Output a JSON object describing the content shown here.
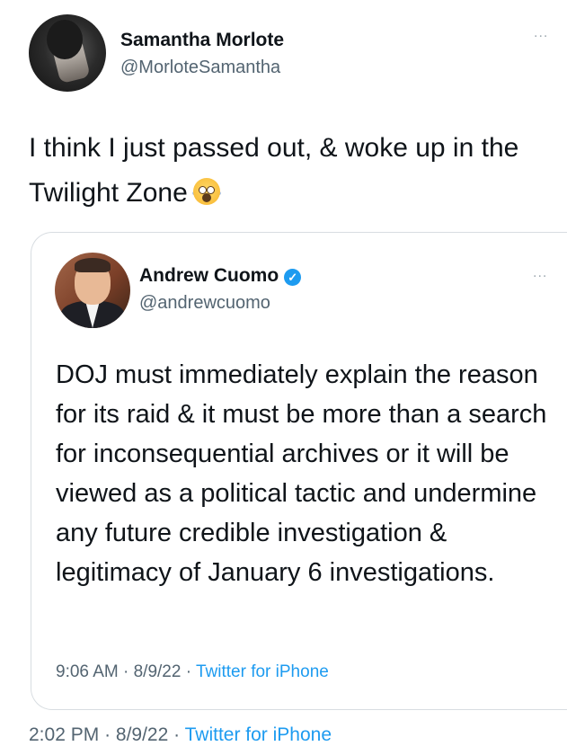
{
  "tweet": {
    "author_name": "Samantha Morlote",
    "author_handle": "@MorloteSamantha",
    "more_icon": "...",
    "text": "I think I just passed out, & woke up in the Twilight Zone",
    "emoji": "face-screaming-in-fear",
    "timestamp": "2:02 PM",
    "date": "8/9/22",
    "separator": "·",
    "source": "Twitter for iPhone"
  },
  "quoted_tweet": {
    "author_name": "Andrew Cuomo",
    "verified_icon": "✓",
    "author_handle": "@andrewcuomo",
    "more_icon": "...",
    "text": "DOJ must immediately explain the reason for its raid & it must be more than a search for inconsequential archives or it will be viewed as a political tactic and undermine any future credible investigation & legitimacy of January 6 investigations.",
    "timestamp": "9:06 AM",
    "date": "8/9/22",
    "separator": "·",
    "source": "Twitter for iPhone"
  },
  "colors": {
    "text": "#0f1419",
    "secondary": "#536471",
    "link": "#1d9bf0",
    "border": "#d8dde1"
  }
}
